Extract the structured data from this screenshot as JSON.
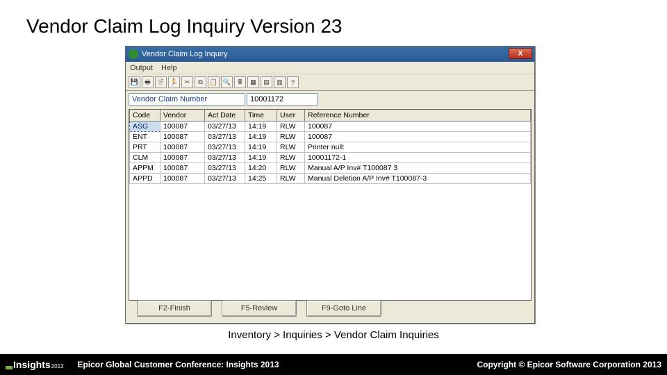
{
  "slide": {
    "title": "Vendor Claim Log Inquiry Version 23"
  },
  "window": {
    "title": "Vendor Claim Log Inquiry",
    "close_label": "X",
    "menu": {
      "output": "Output",
      "help": "Help"
    },
    "filter": {
      "label": "Vendor Claim Number",
      "value": "10001172"
    },
    "columns": {
      "code": "Code",
      "vendor": "Vendor",
      "act_date": "Act Date",
      "time": "Time",
      "user": "User",
      "reference": "Reference Number"
    },
    "rows": [
      {
        "code": "ASG",
        "vendor": "100087",
        "date": "03/27/13",
        "time": "14:19",
        "user": "RLW",
        "ref": "100087"
      },
      {
        "code": "ENT",
        "vendor": "100087",
        "date": "03/27/13",
        "time": "14:19",
        "user": "RLW",
        "ref": "100087"
      },
      {
        "code": "PRT",
        "vendor": "100087",
        "date": "03/27/13",
        "time": "14:19",
        "user": "RLW",
        "ref": "Printer null:"
      },
      {
        "code": "CLM",
        "vendor": "100087",
        "date": "03/27/13",
        "time": "14:19",
        "user": "RLW",
        "ref": "10001172-1"
      },
      {
        "code": "APPM",
        "vendor": "100087",
        "date": "03/27/13",
        "time": "14:20",
        "user": "RLW",
        "ref": "Manual A/P Inv# T100087 3"
      },
      {
        "code": "APPD",
        "vendor": "100087",
        "date": "03/27/13",
        "time": "14:25",
        "user": "RLW",
        "ref": "Manual Deletion A/P Inv# T100087-3"
      }
    ],
    "buttons": {
      "finish": "F2-Finish",
      "review": "F5-Review",
      "goto": "F9-Goto Line"
    }
  },
  "breadcrumb": "Inventory > Inquiries > Vendor Claim Inquiries",
  "footer": {
    "logo_text": "Insights",
    "logo_year": "2013",
    "left": "Epicor Global Customer Conference: Insights 2013",
    "right": "Copyright © Epicor Software Corporation 2013"
  },
  "icons": [
    "save",
    "print",
    "preview",
    "run",
    "cut",
    "copy",
    "paste",
    "find",
    "calc",
    "grid1",
    "grid2",
    "grid3",
    "help"
  ]
}
